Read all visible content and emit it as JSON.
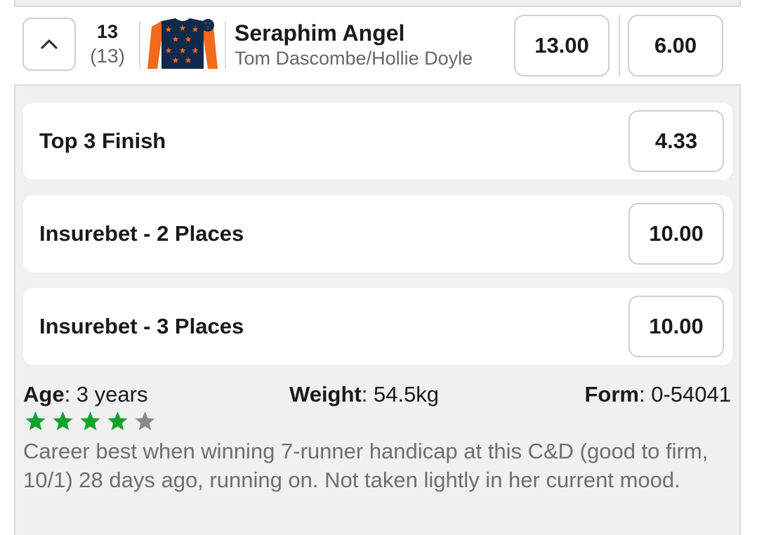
{
  "runner": {
    "saddle_number": "13",
    "draw": "(13)",
    "horse_name": "Seraphim Angel",
    "connections": "Tom Dascombe/Hollie Doyle",
    "win_odds": "13.00",
    "place_odds": "6.00",
    "silks": {
      "body_color": "#102a4c",
      "sleeve_color": "#f26a1b",
      "star_color": "#f26a1b",
      "cap_color": "#102a4c"
    }
  },
  "markets": [
    {
      "label": "Top 3 Finish",
      "odds": "4.33"
    },
    {
      "label": "Insurebet - 2 Places",
      "odds": "10.00"
    },
    {
      "label": "Insurebet - 3 Places",
      "odds": "10.00"
    }
  ],
  "stats": {
    "age_label": "Age",
    "age_value": ": 3 years",
    "weight_label": "Weight",
    "weight_value": ": 54.5kg",
    "form_label": "Form",
    "form_value": ": 0-54041"
  },
  "rating": {
    "filled": 4,
    "total": 5,
    "filled_color": "#0fa32b",
    "empty_color": "#8a8a8a"
  },
  "comment": "Career best when winning 7-runner handicap at this C&D (good to firm, 10/1) 28 days ago, running on. Not taken lightly in her current mood."
}
